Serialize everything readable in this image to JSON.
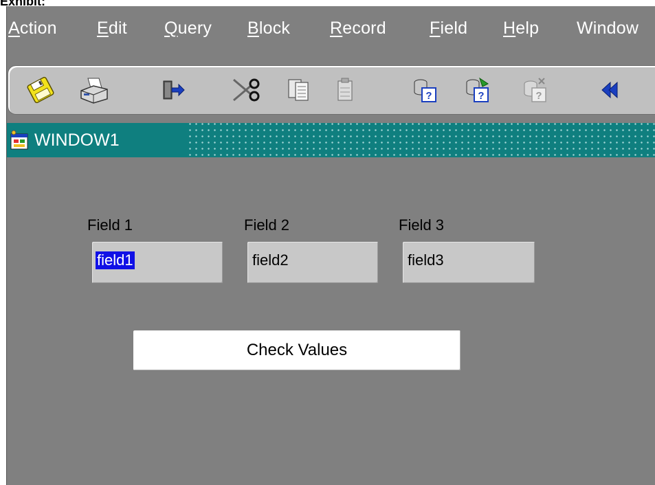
{
  "exhibit_label": "Exhibit:",
  "menu": {
    "items": [
      {
        "pre": "",
        "ul": "A",
        "post": "ction"
      },
      {
        "pre": "",
        "ul": "E",
        "post": "dit"
      },
      {
        "pre": "",
        "ul": "Q",
        "post": "uery"
      },
      {
        "pre": "",
        "ul": "B",
        "post": "lock"
      },
      {
        "pre": "",
        "ul": "R",
        "post": "ecord"
      },
      {
        "pre": "",
        "ul": "F",
        "post": "ield"
      },
      {
        "pre": "",
        "ul": "H",
        "post": "elp"
      },
      {
        "pre": "",
        "ul": "",
        "post": "Window"
      }
    ]
  },
  "toolbar": {
    "icons": [
      "save-icon",
      "print-icon",
      "exit-icon",
      "cut-icon",
      "copy-icon",
      "paste-icon",
      "enter-query-icon",
      "execute-query-icon",
      "cancel-query-icon",
      "previous-block-icon"
    ]
  },
  "window": {
    "title": "WINDOW1"
  },
  "fields": [
    {
      "label": "Field 1",
      "value": "field1"
    },
    {
      "label": "Field 2",
      "value": "field2"
    },
    {
      "label": "Field 3",
      "value": "field3"
    }
  ],
  "button": {
    "label": "Check Values"
  },
  "colors": {
    "background": "#808080",
    "toolbar": "#c0c0c0",
    "titlebar": "#0f7f7f",
    "selection": "#1010e6",
    "field": "#c8c8c8"
  }
}
